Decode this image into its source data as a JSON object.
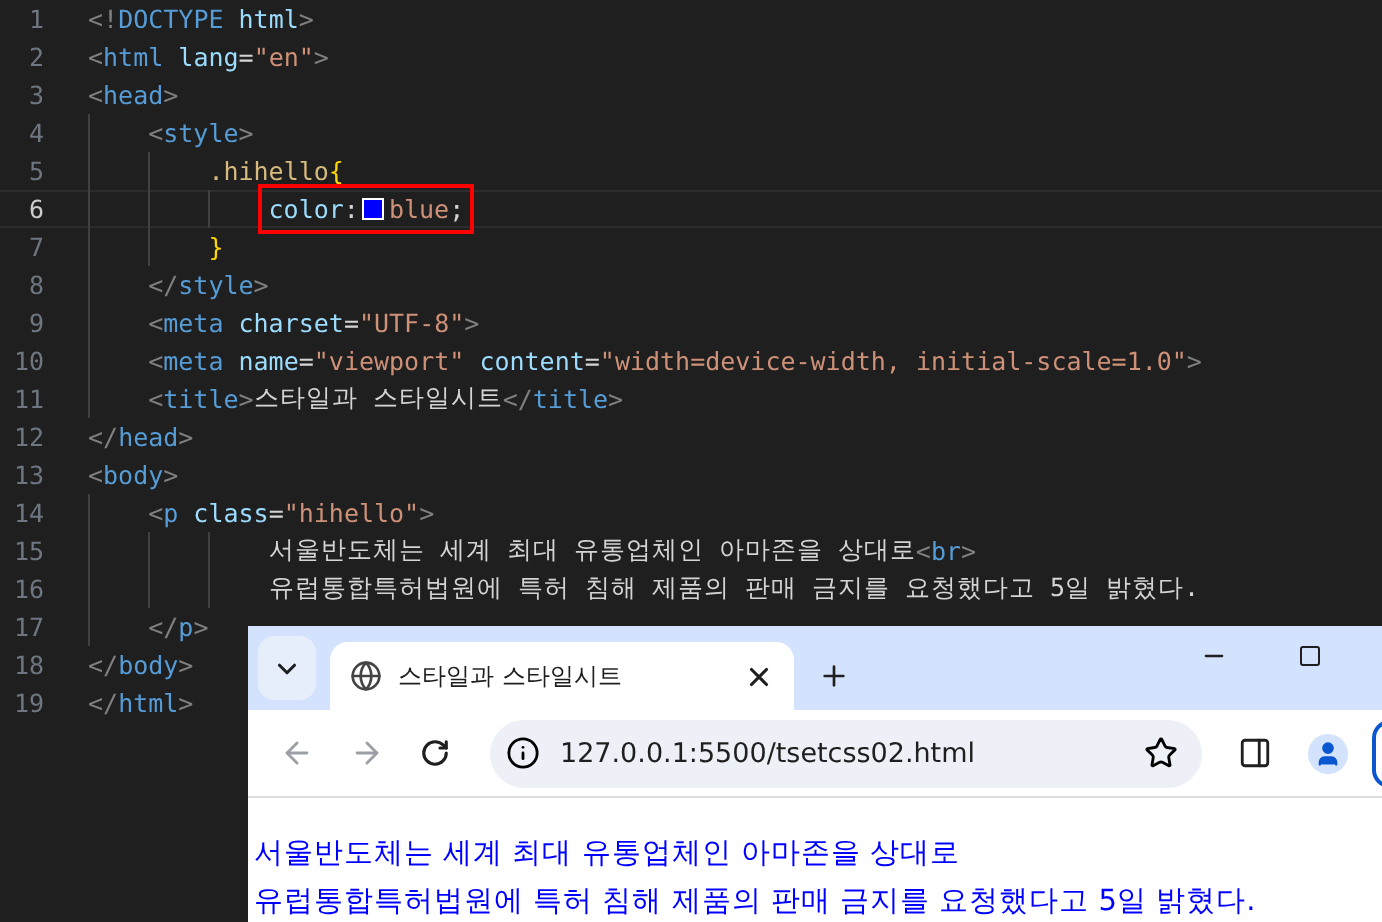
{
  "editor": {
    "lines": [
      {
        "number": "1",
        "kind": "code",
        "current": false,
        "marked": false,
        "tokens": [
          {
            "kind": "punct",
            "text": "<!"
          },
          {
            "kind": "tag",
            "text": "DOCTYPE"
          },
          {
            "kind": "attr",
            "text": " html"
          },
          {
            "kind": "punct",
            "text": ">"
          }
        ]
      },
      {
        "number": "2",
        "kind": "code",
        "current": false,
        "marked": false,
        "tokens": [
          {
            "kind": "punct",
            "text": "<"
          },
          {
            "kind": "tag",
            "text": "html"
          },
          {
            "kind": "attr",
            "text": " lang"
          },
          {
            "kind": "text",
            "text": "="
          },
          {
            "kind": "string",
            "text": "\"en\""
          },
          {
            "kind": "punct",
            "text": ">"
          }
        ]
      },
      {
        "number": "3",
        "kind": "code",
        "current": false,
        "marked": false,
        "tokens": [
          {
            "kind": "punct",
            "text": "<"
          },
          {
            "kind": "tag",
            "text": "head"
          },
          {
            "kind": "punct",
            "text": ">"
          }
        ],
        "children": [
          {
            "number": "4",
            "kind": "code",
            "current": false,
            "marked": false,
            "tokens": [
              {
                "kind": "punct",
                "text": "<"
              },
              {
                "kind": "tag",
                "text": "style"
              },
              {
                "kind": "punct",
                "text": ">"
              }
            ],
            "children": [
              {
                "number": "5",
                "kind": "code",
                "current": false,
                "marked": false,
                "tokens": [
                  {
                    "kind": "selector",
                    "text": ".hihello"
                  },
                  {
                    "kind": "brace",
                    "text": "{"
                  }
                ],
                "children": [
                  {
                    "number": "6",
                    "kind": "code",
                    "current": true,
                    "marked": true,
                    "tokens": [
                      {
                        "kind": "property",
                        "text": "color"
                      },
                      {
                        "kind": "text",
                        "text": ":"
                      },
                      {
                        "kind": "swatch",
                        "color": "#0000ff"
                      },
                      {
                        "kind": "string",
                        "text": "blue"
                      },
                      {
                        "kind": "text",
                        "text": ";"
                      }
                    ]
                  }
                ]
              },
              {
                "number": "7",
                "kind": "code",
                "current": false,
                "marked": false,
                "tokens": [
                  {
                    "kind": "brace",
                    "text": "}"
                  }
                ]
              }
            ]
          },
          {
            "number": "8",
            "kind": "code",
            "current": false,
            "marked": false,
            "tokens": [
              {
                "kind": "punct",
                "text": "</"
              },
              {
                "kind": "tag",
                "text": "style"
              },
              {
                "kind": "punct",
                "text": ">"
              }
            ]
          },
          {
            "number": "9",
            "kind": "code",
            "current": false,
            "marked": false,
            "tokens": [
              {
                "kind": "punct",
                "text": "<"
              },
              {
                "kind": "tag",
                "text": "meta"
              },
              {
                "kind": "attr",
                "text": " charset"
              },
              {
                "kind": "text",
                "text": "="
              },
              {
                "kind": "string",
                "text": "\"UTF-8\""
              },
              {
                "kind": "punct",
                "text": ">"
              }
            ]
          },
          {
            "number": "10",
            "kind": "code",
            "current": false,
            "marked": false,
            "tokens": [
              {
                "kind": "punct",
                "text": "<"
              },
              {
                "kind": "tag",
                "text": "meta"
              },
              {
                "kind": "attr",
                "text": " name"
              },
              {
                "kind": "text",
                "text": "="
              },
              {
                "kind": "string",
                "text": "\"viewport\""
              },
              {
                "kind": "attr",
                "text": " content"
              },
              {
                "kind": "text",
                "text": "="
              },
              {
                "kind": "string",
                "text": "\"width=device-width, initial-scale=1.0\""
              },
              {
                "kind": "punct",
                "text": ">"
              }
            ]
          },
          {
            "number": "11",
            "kind": "code",
            "current": false,
            "marked": false,
            "tokens": [
              {
                "kind": "punct",
                "text": "<"
              },
              {
                "kind": "tag",
                "text": "title"
              },
              {
                "kind": "punct",
                "text": ">"
              },
              {
                "kind": "text",
                "text": "스타일과 스타일시트"
              },
              {
                "kind": "punct",
                "text": "</"
              },
              {
                "kind": "tag",
                "text": "title"
              },
              {
                "kind": "punct",
                "text": ">"
              }
            ]
          }
        ]
      },
      {
        "number": "12",
        "kind": "code",
        "current": false,
        "marked": false,
        "tokens": [
          {
            "kind": "punct",
            "text": "</"
          },
          {
            "kind": "tag",
            "text": "head"
          },
          {
            "kind": "punct",
            "text": ">"
          }
        ]
      },
      {
        "number": "13",
        "kind": "code",
        "current": false,
        "marked": false,
        "tokens": [
          {
            "kind": "punct",
            "text": "<"
          },
          {
            "kind": "tag",
            "text": "body"
          },
          {
            "kind": "punct",
            "text": ">"
          }
        ],
        "children": [
          {
            "number": "14",
            "kind": "code",
            "current": false,
            "marked": false,
            "tokens": [
              {
                "kind": "punct",
                "text": "<"
              },
              {
                "kind": "tag",
                "text": "p"
              },
              {
                "kind": "attr",
                "text": " class"
              },
              {
                "kind": "text",
                "text": "="
              },
              {
                "kind": "string",
                "text": "\"hihello\""
              },
              {
                "kind": "punct",
                "text": ">"
              }
            ],
            "children": [
              {
                "number": "15",
                "kind": "content",
                "current": false,
                "marked": false,
                "tokens": [
                  {
                    "kind": "text",
                    "text": "서울반도체는 세계 최대 유통업체인 아마존을 상대로"
                  },
                  {
                    "kind": "punct",
                    "text": "<"
                  },
                  {
                    "kind": "tag",
                    "text": "br"
                  },
                  {
                    "kind": "punct",
                    "text": ">"
                  }
                ]
              },
              {
                "number": "16",
                "kind": "content",
                "current": false,
                "marked": false,
                "tokens": [
                  {
                    "kind": "text",
                    "text": "유럽통합특허법원에 특허 침해 제품의 판매 금지를 요청했다고 5일 밝혔다."
                  }
                ]
              }
            ]
          },
          {
            "number": "17",
            "kind": "code",
            "current": false,
            "marked": false,
            "tokens": [
              {
                "kind": "punct",
                "text": "</"
              },
              {
                "kind": "tag",
                "text": "p"
              },
              {
                "kind": "punct",
                "text": ">"
              }
            ]
          }
        ]
      },
      {
        "number": "18",
        "kind": "code",
        "current": false,
        "marked": false,
        "tokens": [
          {
            "kind": "punct",
            "text": "</"
          },
          {
            "kind": "tag",
            "text": "body"
          },
          {
            "kind": "punct",
            "text": ">"
          }
        ]
      },
      {
        "number": "19",
        "kind": "code",
        "current": false,
        "marked": false,
        "tokens": [
          {
            "kind": "punct",
            "text": "</"
          },
          {
            "kind": "tag",
            "text": "html"
          },
          {
            "kind": "punct",
            "text": ">"
          }
        ]
      }
    ]
  },
  "browser": {
    "tab": {
      "title": "스타일과 스타일시트",
      "selected": true
    },
    "back_disabled": true,
    "forward_disabled": true,
    "address": "127.0.0.1:5500/tsetcss02.html",
    "content": {
      "color": "#0000ff",
      "lines": [
        "서울반도체는 세계 최대 유통업체인 아마존을 상대로",
        "유럽통합특허법원에 특허 침해 제품의 판매 금지를 요청했다고 5일 밝혔다."
      ]
    }
  }
}
